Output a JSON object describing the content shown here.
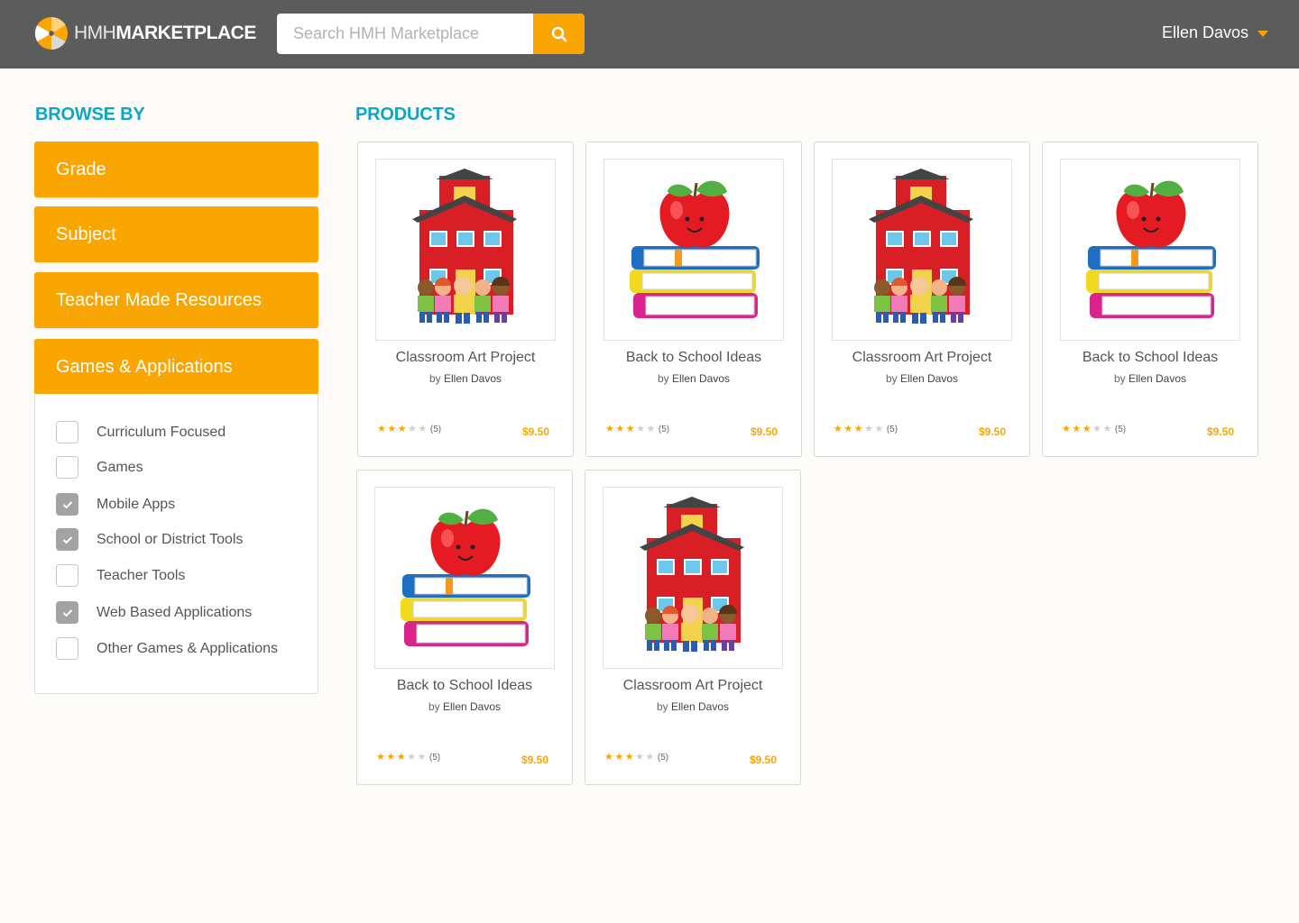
{
  "header": {
    "logo_light": "HMH",
    "logo_bold": "MARKETPLACE",
    "search_placeholder": "Search HMH Marketplace",
    "user_name": "Ellen Davos",
    "accent_color": "#f9a602",
    "bg_color": "#5c5c5c"
  },
  "sidebar": {
    "title": "BROWSE BY",
    "categories": [
      {
        "label": "Grade"
      },
      {
        "label": "Subject"
      },
      {
        "label": "Teacher Made Resources"
      },
      {
        "label": "Games & Applications"
      }
    ],
    "filters": [
      {
        "label": "Curriculum Focused",
        "checked": false
      },
      {
        "label": "Games",
        "checked": false
      },
      {
        "label": "Mobile Apps",
        "checked": true
      },
      {
        "label": "School or District Tools",
        "checked": true
      },
      {
        "label": "Teacher Tools",
        "checked": false
      },
      {
        "label": "Web Based Applications",
        "checked": true
      },
      {
        "label": "Other Games & Applications",
        "checked": false
      }
    ]
  },
  "main": {
    "title": "PRODUCTS",
    "products": [
      {
        "title": "Classroom Art Project",
        "by": "by",
        "author": "Ellen Davos",
        "rating": 3,
        "rating_count": "(5)",
        "price": "$9.50",
        "image": "schoolhouse-icon"
      },
      {
        "title": "Back to School Ideas",
        "by": "by",
        "author": "Ellen Davos",
        "rating": 3,
        "rating_count": "(5)",
        "price": "$9.50",
        "image": "apple-books-icon"
      },
      {
        "title": "Classroom Art Project",
        "by": "by",
        "author": "Ellen Davos",
        "rating": 3,
        "rating_count": "(5)",
        "price": "$9.50",
        "image": "schoolhouse-icon"
      },
      {
        "title": "Back to School Ideas",
        "by": "by",
        "author": "Ellen Davos",
        "rating": 3,
        "rating_count": "(5)",
        "price": "$9.50",
        "image": "apple-books-icon"
      },
      {
        "title": "Back to School Ideas",
        "by": "by",
        "author": "Ellen Davos",
        "rating": 3,
        "rating_count": "(5)",
        "price": "$9.50",
        "image": "apple-books-icon"
      },
      {
        "title": "Classroom Art Project",
        "by": "by",
        "author": "Ellen Davos",
        "rating": 3,
        "rating_count": "(5)",
        "price": "$9.50",
        "image": "schoolhouse-icon"
      }
    ]
  }
}
